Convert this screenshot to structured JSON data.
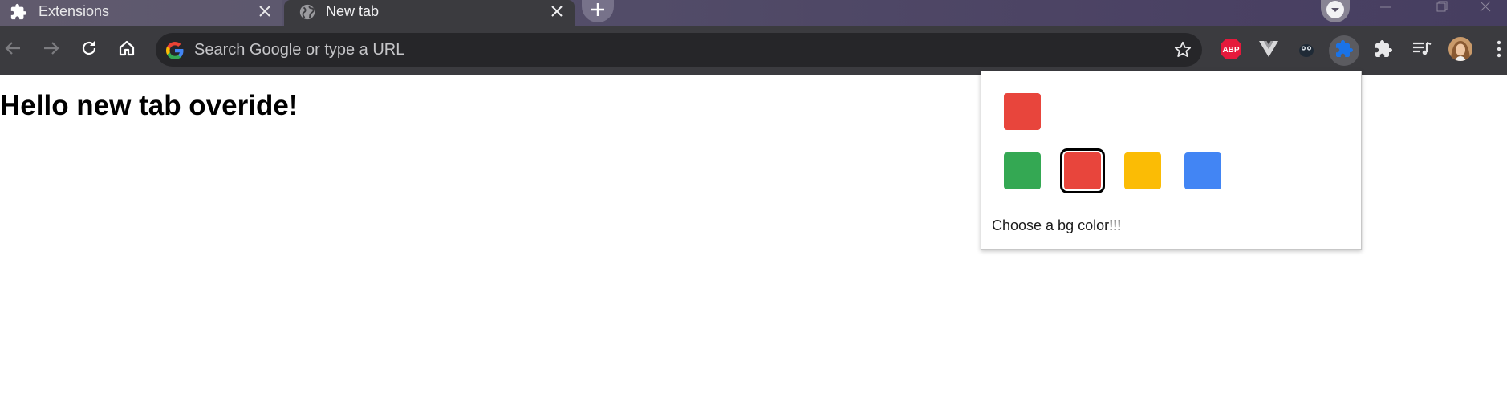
{
  "tabs": [
    {
      "title": "Extensions",
      "icon": "puzzle-icon",
      "active": false
    },
    {
      "title": "New tab",
      "icon": "globe-icon",
      "active": true
    }
  ],
  "omnibox": {
    "placeholder": "Search Google or type a URL",
    "value": ""
  },
  "toolbar": {
    "extensions": [
      {
        "name": "adblock-plus",
        "badge": "ABP",
        "color": "#e5193c"
      },
      {
        "name": "vue-devtools",
        "color": "#d8d8da"
      },
      {
        "name": "owl-extension",
        "color": "#1f2a36"
      },
      {
        "name": "custom-extension",
        "color": "#1a73e8",
        "active": true
      },
      {
        "name": "extensions-menu",
        "color": "#e8e8ea"
      }
    ]
  },
  "page": {
    "heading": "Hello new tab overide!"
  },
  "popup": {
    "caption": "Choose a bg color!!!",
    "current_color": "#e8453c",
    "options": [
      {
        "name": "green",
        "color": "#34a853"
      },
      {
        "name": "red",
        "color": "#e8453c",
        "selected": true
      },
      {
        "name": "yellow",
        "color": "#fbbc05"
      },
      {
        "name": "blue",
        "color": "#4285f4"
      }
    ]
  }
}
